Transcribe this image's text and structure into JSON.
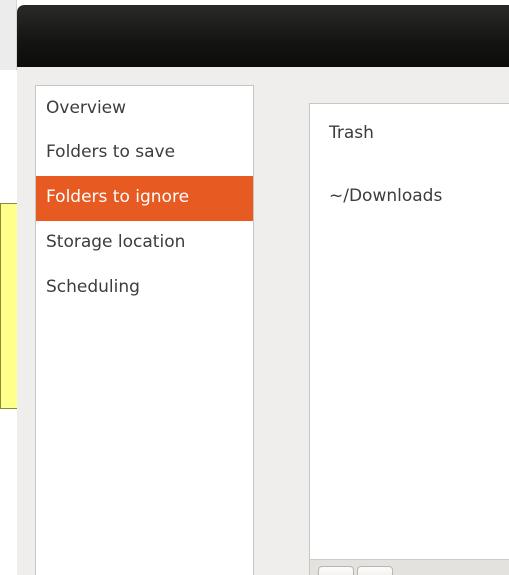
{
  "sidebar": {
    "items": [
      {
        "label": "Overview"
      },
      {
        "label": "Folders to save"
      },
      {
        "label": "Folders to ignore"
      },
      {
        "label": "Storage location"
      },
      {
        "label": "Scheduling"
      }
    ],
    "selected_index": 2
  },
  "content": {
    "items": [
      {
        "label": "Trash"
      },
      {
        "label": "~/Downloads"
      }
    ]
  },
  "toolbar": {
    "buttons": [
      {
        "icon": "add-icon"
      },
      {
        "icon": "remove-icon"
      }
    ]
  },
  "colors": {
    "accent": "#e75a22",
    "titlebar": "#141413",
    "note": "#ffff8c"
  }
}
